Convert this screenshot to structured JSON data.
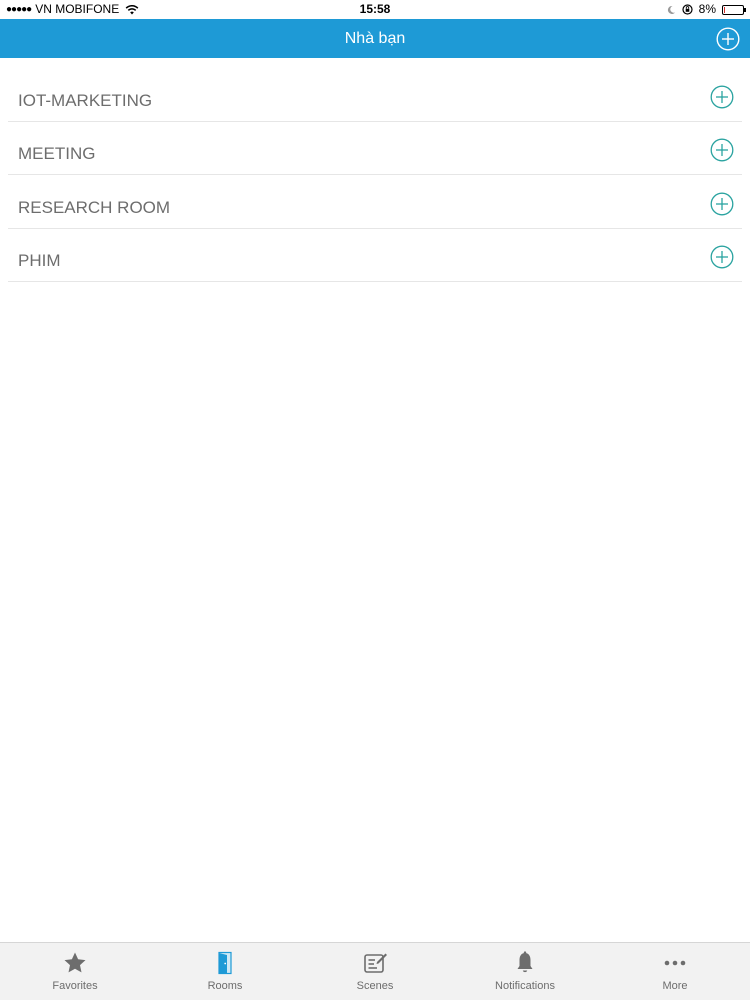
{
  "status_bar": {
    "carrier": "VN MOBIFONE",
    "time": "15:58",
    "battery": "8%",
    "battery_level": 0.08
  },
  "nav": {
    "title": "Nhà bạn",
    "add_icon": "plus-circle-icon"
  },
  "rooms": [
    {
      "name": "IOT-MARKETING"
    },
    {
      "name": "MEETING"
    },
    {
      "name": "RESEARCH ROOM"
    },
    {
      "name": "PHIM"
    }
  ],
  "tabs": [
    {
      "label": "Favorites",
      "icon": "star-icon",
      "active": false
    },
    {
      "label": "Rooms",
      "icon": "door-icon",
      "active": true
    },
    {
      "label": "Scenes",
      "icon": "scene-edit-icon",
      "active": false
    },
    {
      "label": "Notifications",
      "icon": "bell-icon",
      "active": false
    },
    {
      "label": "More",
      "icon": "more-dots-icon",
      "active": false
    }
  ],
  "colors": {
    "accent": "#1e9ad6",
    "icon_teal": "#2aa3a0",
    "tab_inactive": "#6d6d6d",
    "text_gray": "#6d6d6d"
  }
}
